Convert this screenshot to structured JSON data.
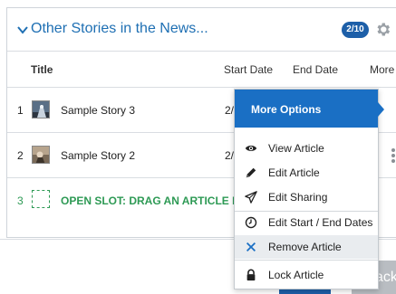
{
  "panel": {
    "title": "Other Stories in the News...",
    "count_badge": "2/10"
  },
  "columns": {
    "title": "Title",
    "start_date": "Start Date",
    "end_date": "End Date",
    "more": "More"
  },
  "rows": [
    {
      "num": "1",
      "title": "Sample Story 3",
      "start": "2/"
    },
    {
      "num": "2",
      "title": "Sample Story 2",
      "start": "2/"
    }
  ],
  "slot": {
    "num": "3",
    "text": "OPEN SLOT: DRAG AN ARTICLE HER"
  },
  "menu": {
    "header": "More Options",
    "items": [
      {
        "label": "View Article",
        "icon": "eye-icon"
      },
      {
        "label": "Edit Article",
        "icon": "pencil-icon"
      },
      {
        "label": "Edit Sharing",
        "icon": "paper-plane-icon"
      },
      {
        "label": "Edit Start / End Dates",
        "icon": "clock-icon"
      },
      {
        "label": "Remove Article",
        "icon": "x-icon"
      },
      {
        "label": "Lock Article",
        "icon": "lock-icon"
      }
    ]
  },
  "back_button": {
    "label": "ack"
  },
  "colors": {
    "accent": "#1a6fc4",
    "title_blue": "#1e6fb3",
    "slot_green": "#2e9a55",
    "badge": "#1d5fa8"
  }
}
